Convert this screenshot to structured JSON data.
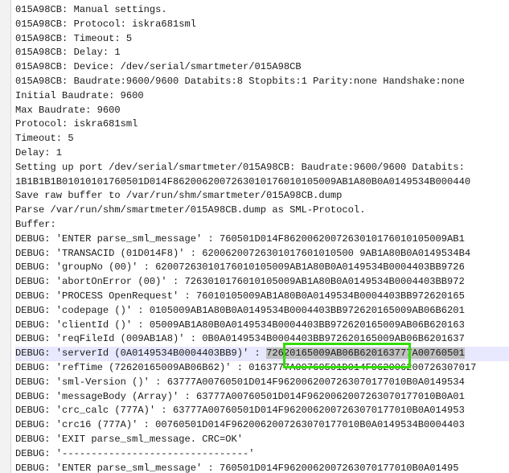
{
  "log": {
    "lines": [
      "015A98CB: Manual settings.",
      "015A98CB: Protocol: iskra681sml",
      "015A98CB: Timeout: 5",
      "015A98CB: Delay: 1",
      "015A98CB: Device: /dev/serial/smartmeter/015A98CB",
      "015A98CB: Baudrate:9600/9600 Databits:8 Stopbits:1 Parity:none Handshake:none",
      "Initial Baudrate: 9600",
      "Max Baudrate: 9600",
      "Protocol: iskra681sml",
      "Timeout: 5",
      "Delay: 1",
      "Setting up port /dev/serial/smartmeter/015A98CB: Baudrate:9600/9600 Databits:",
      "1B1B1B1B01010101760501D014F8620062007263010176010105009AB1A80B0A0149534B000440",
      "Save raw buffer to /var/run/shm/smartmeter/015A98CB.dump",
      "Parse /var/run/shm/smartmeter/015A98CB.dump as SML-Protocol.",
      "Buffer:",
      "DEBUG: 'ENTER parse_sml_message' : 760501D014F8620062007263010176010105009AB1",
      "DEBUG: 'TRANSACID (01D014F8)' : 62006200726301017601010500 9AB1A80B0A0149534B4",
      "DEBUG: 'groupNo (00)' : 62007263010176010105009AB1A80B0A0149534B0004403BB9726",
      "DEBUG: 'abortOnError (00)' : 7263010176010105009AB1A80B0A0149534B0004403BB972",
      "DEBUG: 'PROCESS OpenRequest' : 76010105009AB1A80B0A0149534B0004403BB972620165",
      "DEBUG: 'codepage ()' : 0105009AB1A80B0A0149534B0004403BB972620165009AB06B6201",
      "DEBUG: 'clientId ()' : 05009AB1A80B0A0149534B0004403BB972620165009AB06B620163",
      "DEBUG: 'reqFileId (009AB1A8)' : 0B0A0149534B0004403BB972620165009AB06B6201637",
      "",
      "DEBUG: 'refTime (72620165009AB06B62)' : 0163777A00760501D014F962006200726307017",
      "DEBUG: 'sml-Version ()' : 63777A00760501D014F9620062007263070177010B0A0149534",
      "DEBUG: 'messageBody (Array)' : 63777A00760501D014F9620062007263070177010B0A01",
      "DEBUG: 'crc_calc (777A)' : 63777A00760501D014F9620062007263070177010B0A014953",
      "DEBUG: 'crc16 (777A)' : 00760501D014F9620062007263070177010B0A0149534B0004403",
      "DEBUG: 'EXIT parse_sml_message. CRC=OK'",
      "DEBUG: '--------------------------------'",
      "DEBUG: 'ENTER parse_sml_message' : 760501D014F9620062007263070177010B0A01495"
    ],
    "current_line": {
      "before": "DEBUG: 'serverId (0A0149534B0004403BB9)' : ",
      "selected": "72620165009AB06B62",
      "after": "0163777A00760501"
    }
  }
}
